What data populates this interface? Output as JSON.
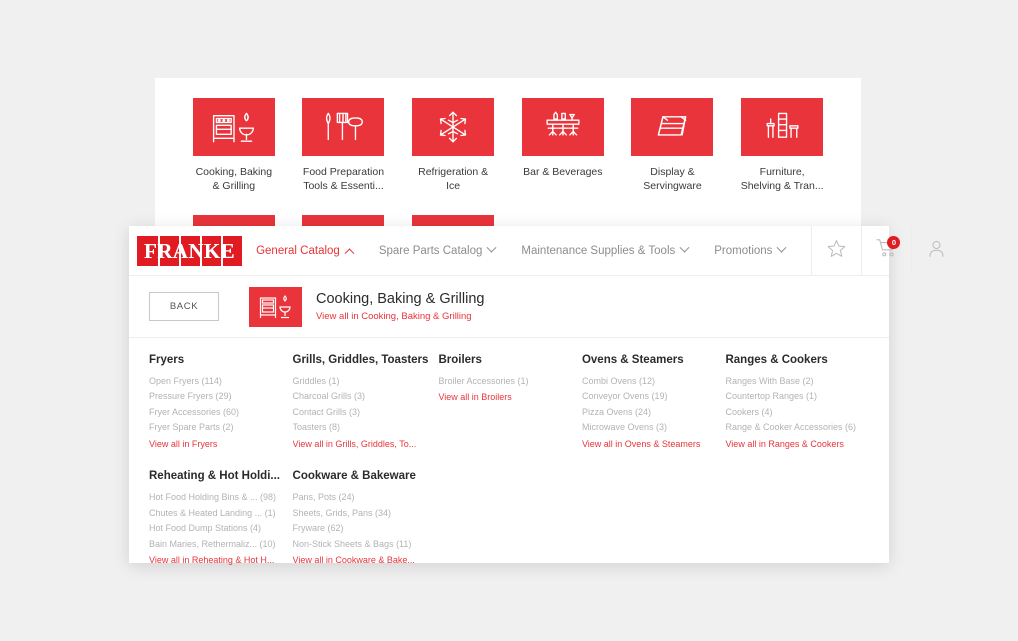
{
  "theme": {
    "brand_red": "#e8343a",
    "logo_red": "#e01b22",
    "muted_text": "#b3b3b3",
    "page_bg": "#f0f0f0"
  },
  "background_grid": {
    "tiles": [
      {
        "icon": "oven-grill-icon",
        "label": "Cooking, Baking\n& Grilling"
      },
      {
        "icon": "utensils-icon",
        "label": "Food Preparation\nTools & Essenti..."
      },
      {
        "icon": "snowflake-icon",
        "label": "Refrigeration &\nIce"
      },
      {
        "icon": "bar-counter-icon",
        "label": "Bar & Beverages"
      },
      {
        "icon": "display-case-icon",
        "label": "Display &\nServingware"
      },
      {
        "icon": "shelving-icon",
        "label": "Furniture,\nShelving & Tran..."
      },
      {
        "icon": "cleaning-icon",
        "label": ""
      },
      {
        "icon": "safety-icon",
        "label": ""
      },
      {
        "icon": "smallwares-icon",
        "label": ""
      }
    ]
  },
  "navbar": {
    "logo_text": "FRANKE",
    "links": [
      {
        "label": "General Catalog",
        "active": true,
        "caret": "up"
      },
      {
        "label": "Spare Parts Catalog",
        "active": false,
        "caret": "down"
      },
      {
        "label": "Maintenance Supplies & Tools",
        "active": false,
        "caret": "down"
      },
      {
        "label": "Promotions",
        "active": false,
        "caret": "down"
      }
    ],
    "actions": [
      {
        "icon": "star-icon",
        "name": "favorites-button"
      },
      {
        "icon": "cart-icon",
        "name": "cart-button",
        "badge": "0"
      },
      {
        "icon": "user-icon",
        "name": "account-button"
      }
    ]
  },
  "category_header": {
    "back_label": "BACK",
    "icon": "oven-grill-icon",
    "title": "Cooking, Baking & Grilling",
    "view_all_label": "View all in Cooking, Baking & Grilling"
  },
  "columns": [
    {
      "groups": [
        {
          "title": "Fryers",
          "links": [
            "Open Fryers (114)",
            "Pressure Fryers (29)",
            "Fryer Accessories (60)",
            "Fryer Spare Parts (2)"
          ],
          "view_all": "View all in Fryers"
        },
        {
          "title": "Reheating & Hot Holdi...",
          "links": [
            "Hot Food Holding Bins & ... (98)",
            "Chutes & Heated Landing ... (1)",
            "Hot Food Dump Stations (4)",
            "Bain Maries, Rethermaliz... (10)"
          ],
          "view_all": "View all in Reheating & Hot H..."
        }
      ]
    },
    {
      "groups": [
        {
          "title": "Grills, Griddles, Toasters",
          "links": [
            "Griddles (1)",
            "Charcoal Grills (3)",
            "Contact Grills (3)",
            "Toasters (8)"
          ],
          "view_all": "View all in Grills, Griddles, To..."
        },
        {
          "title": "Cookware & Bakeware",
          "links": [
            "Pans, Pots (24)",
            "Sheets, Grids, Pans (34)",
            "Fryware (62)",
            "Non-Stick Sheets & Bags (11)"
          ],
          "view_all": "View all in Cookware & Bake..."
        }
      ]
    },
    {
      "groups": [
        {
          "title": "Broilers",
          "links": [
            "Broiler Accessories (1)"
          ],
          "view_all": "View all in Broilers"
        }
      ]
    },
    {
      "groups": [
        {
          "title": "Ovens & Steamers",
          "links": [
            "Combi Ovens (12)",
            "Conveyor Ovens (19)",
            "Pizza Ovens (24)",
            "Microwave Ovens (3)"
          ],
          "view_all": "View all in Ovens & Steamers"
        }
      ]
    },
    {
      "groups": [
        {
          "title": "Ranges & Cookers",
          "links": [
            "Ranges With Base (2)",
            "Countertop Ranges (1)",
            "Cookers (4)",
            "Range & Cooker Accessories (6)"
          ],
          "view_all": "View all in Ranges & Cookers"
        }
      ]
    }
  ]
}
